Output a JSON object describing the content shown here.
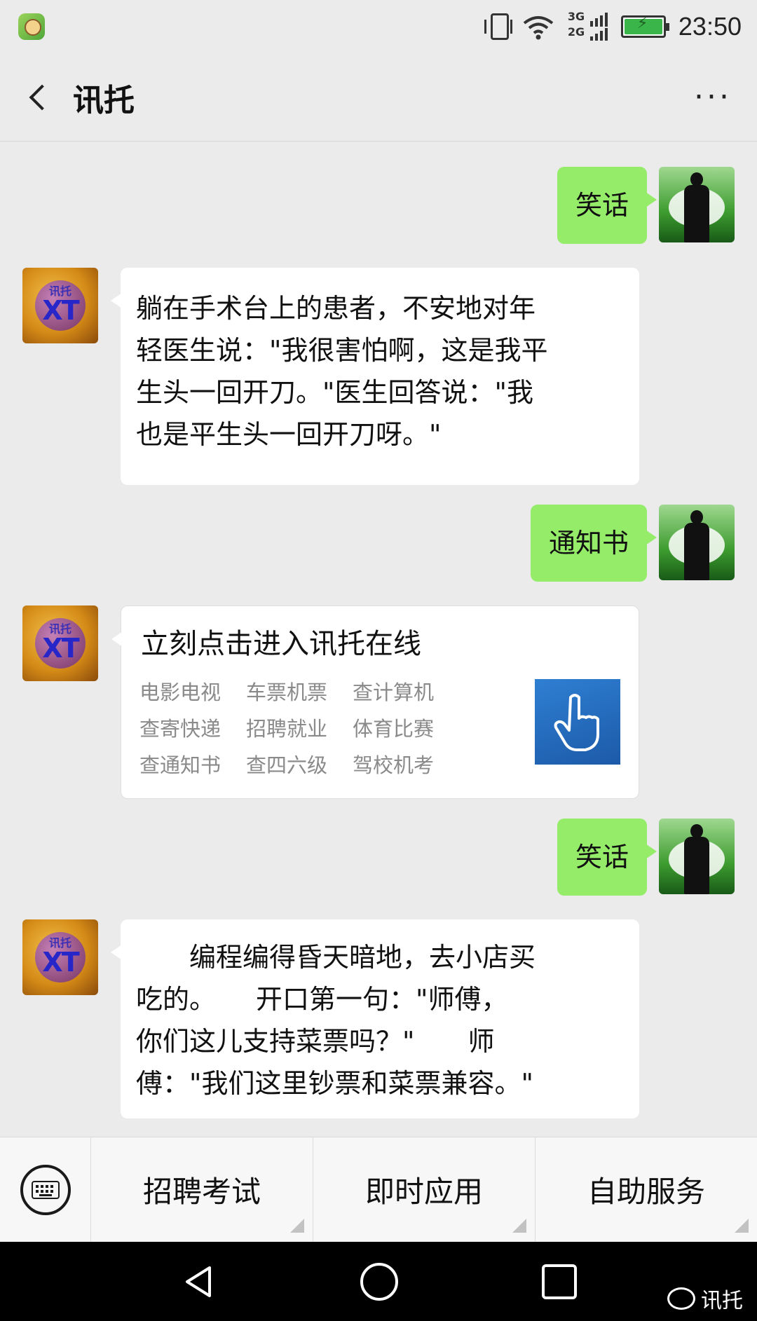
{
  "status_bar": {
    "time": "23:50",
    "network_top": "3G",
    "network_bottom": "2G",
    "icons": [
      "app-notification-icon",
      "vibrate-icon",
      "wifi-icon",
      "signal-icon",
      "battery-charging-icon"
    ]
  },
  "header": {
    "title": "讯托",
    "more_label": "···"
  },
  "bot_avatar": {
    "logo_cn": "讯托",
    "logo_en": "XT"
  },
  "messages": [
    {
      "from": "user",
      "text": "笑话"
    },
    {
      "from": "bot",
      "lines": [
        "躺在手术台上的患者，不安地对年",
        "轻医生说：\"我很害怕啊，这是我平",
        "生头一回开刀。\"医生回答说：\"我",
        "也是平生头一回开刀呀。\""
      ]
    },
    {
      "from": "user",
      "text": "通知书"
    },
    {
      "from": "bot_card",
      "title": "立刻点击进入讯托在线",
      "links": [
        "电影电视",
        "车票机票",
        "查计算机",
        "查寄快递",
        "招聘就业",
        "体育比赛",
        "查通知书",
        "查四六级",
        "驾校机考"
      ]
    },
    {
      "from": "user",
      "text": "笑话"
    },
    {
      "from": "bot",
      "lines": [
        "　　编程编得昏天暗地，去小店买",
        "吃的。　　开口第一句：\"师傅，",
        "你们这儿支持菜票吗？\"　　师",
        "傅：\"我们这里钞票和菜票兼容。\""
      ]
    }
  ],
  "menu": {
    "items": [
      "招聘考试",
      "即时应用",
      "自助服务"
    ]
  },
  "watermark": {
    "text": "讯托"
  },
  "colors": {
    "background": "#ebebeb",
    "user_bubble": "#95ec69",
    "bot_bubble": "#ffffff",
    "link_gray": "#8a8a8a"
  }
}
